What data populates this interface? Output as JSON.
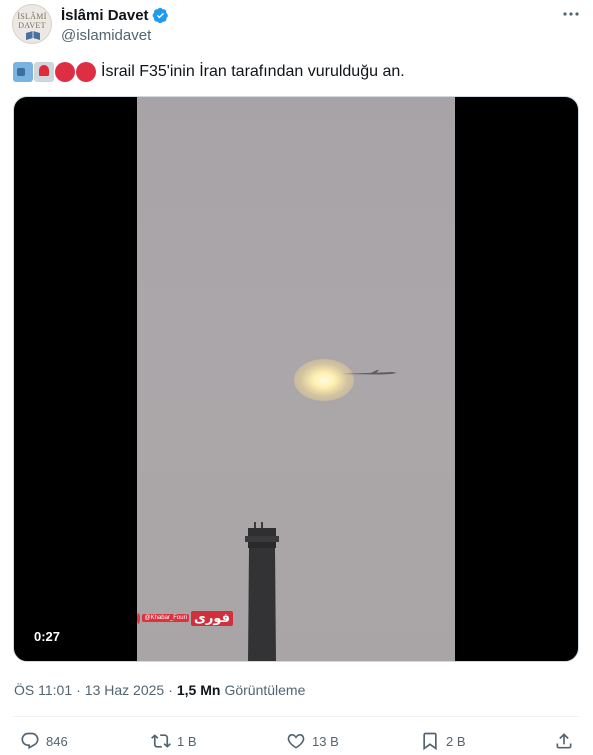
{
  "author": {
    "display_name": "İslâmi Davet",
    "handle": "@islamidavet",
    "avatar_text_line1": "İSLÂMİ",
    "avatar_text_line2": "DAVET",
    "verified_color": "#1d9bf0"
  },
  "tweet": {
    "emojis": [
      "movie-camera",
      "police-light",
      "red-circle",
      "red-circle"
    ],
    "text": "İsrail F35'inin İran tarafından vurulduğu an."
  },
  "media": {
    "duration": "0:27",
    "watermark_handle": "@Khabar_Fouri",
    "watermark_logo": "فوری"
  },
  "meta": {
    "time": "ÖS 11:01",
    "separator": "·",
    "date": "13 Haz 2025",
    "views_count": "1,5 Mn",
    "views_label": "Görüntüleme"
  },
  "actions": {
    "replies": "846",
    "reposts": "1 B",
    "likes": "13 B",
    "bookmarks": "2 B"
  },
  "icons": {
    "reply": "reply-icon",
    "repost": "repost-icon",
    "like": "heart-icon",
    "bookmark": "bookmark-icon",
    "share": "share-icon",
    "more": "more-icon"
  },
  "colors": {
    "text": "#0f1419",
    "secondary": "#536471",
    "accent": "#1d9bf0"
  }
}
